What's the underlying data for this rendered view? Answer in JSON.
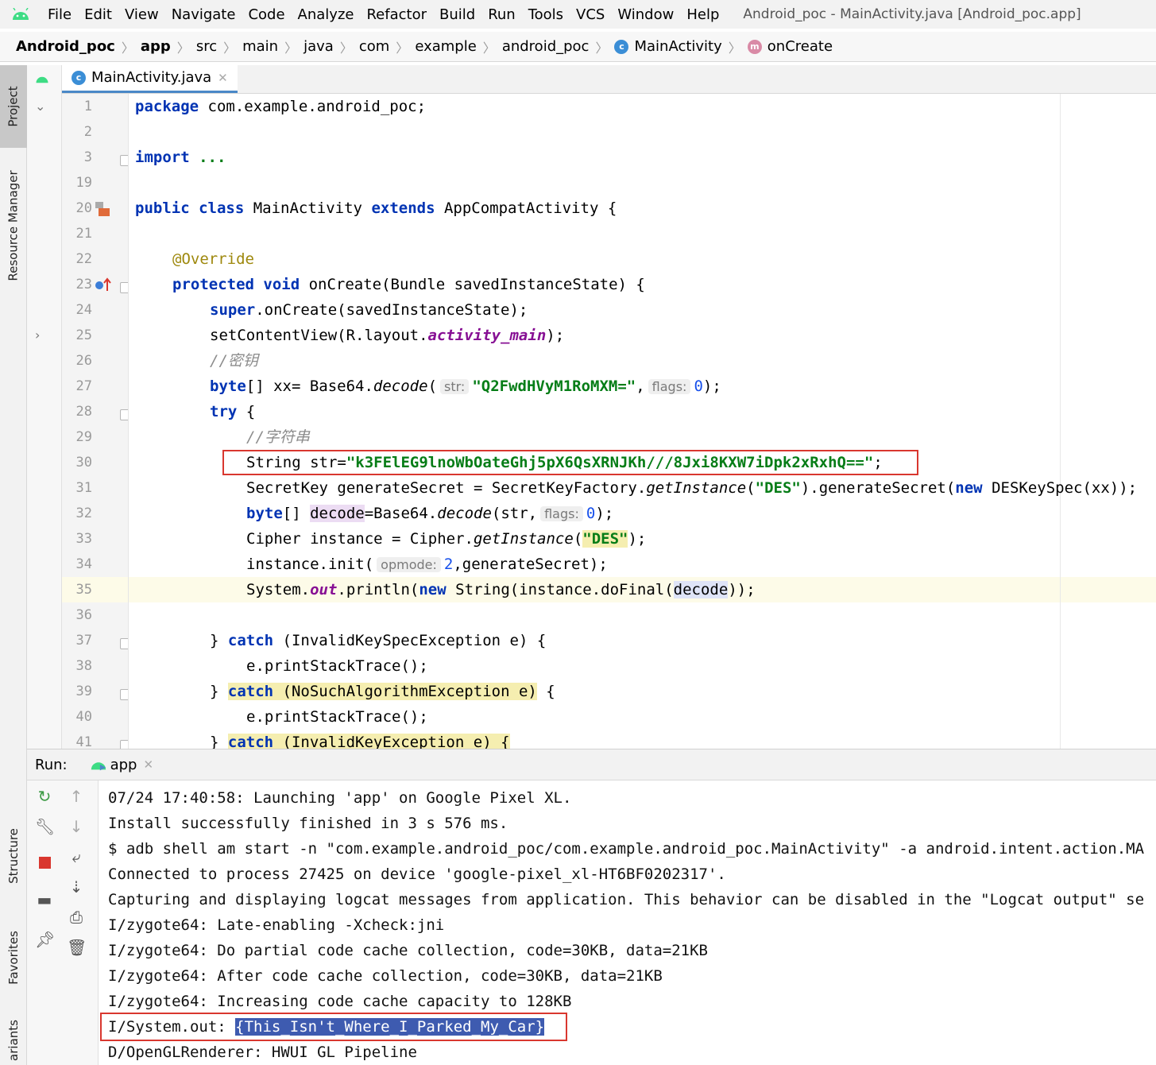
{
  "menubar": {
    "items": [
      "File",
      "Edit",
      "View",
      "Navigate",
      "Code",
      "Analyze",
      "Refactor",
      "Build",
      "Run",
      "Tools",
      "VCS",
      "Window",
      "Help"
    ],
    "window_title": "Android_poc - MainActivity.java [Android_poc.app]"
  },
  "breadcrumb": [
    "Android_poc",
    "app",
    "src",
    "main",
    "java",
    "com",
    "example",
    "android_poc",
    "MainActivity",
    "onCreate"
  ],
  "left_strip": {
    "project": "Project",
    "resource_manager": "Resource Manager",
    "structure": "Structure",
    "favorites": "Favorites",
    "variants": "ariants"
  },
  "editor": {
    "tab_label": "MainActivity.java",
    "badge_c": "c",
    "badge_m": "m",
    "line_numbers": [
      "1",
      "2",
      "3",
      "19",
      "20",
      "21",
      "22",
      "23",
      "24",
      "25",
      "26",
      "27",
      "28",
      "29",
      "30",
      "31",
      "32",
      "33",
      "34",
      "35",
      "36",
      "37",
      "38",
      "39",
      "40",
      "41"
    ],
    "code": {
      "l1_kw": "package",
      "l1_rest": " com.example.android_poc;",
      "l3_kw": "import",
      "l3_rest": " ...",
      "l20_kw1": "public class",
      "l20_mid": " MainActivity ",
      "l20_kw2": "extends",
      "l20_rest": " AppCompatActivity {",
      "l22_ann": "@Override",
      "l23_kw": "protected void",
      "l23_rest": " onCreate(Bundle savedInstanceState) {",
      "l24_kw": "super",
      "l24_rest": ".onCreate(savedInstanceState);",
      "l25_a": "setContentView(R.layout.",
      "l25_fld": "activity_main",
      "l25_b": ");",
      "l26_cmt": "//密钥",
      "l27_kw": "byte",
      "l27_a": "[] xx= Base64.",
      "l27_ital": "decode",
      "l27_b": "(",
      "l27_hint1": "str:",
      "l27_str": "\"Q2FwdHVyM1RoMXM=\"",
      "l27_c": ",",
      "l27_hint2": "flags:",
      "l27_num": "0",
      "l27_d": ");",
      "l28_kw": "try",
      "l28_rest": " {",
      "l29_cmt": "//字符串",
      "l30_a": "String str=",
      "l30_str": "\"k3FElEG9lnoWbOateGhj5pX6QsXRNJKh///8Jxi8KXW7iDpk2xRxhQ==\"",
      "l30_b": ";",
      "l31_a": "SecretKey generateSecret = SecretKeyFactory.",
      "l31_ital": "getInstance",
      "l31_b": "(",
      "l31_str": "\"DES\"",
      "l31_c": ").generateSecret(",
      "l31_kw": "new",
      "l31_d": " DESKeySpec(xx));",
      "l32_kw": "byte",
      "l32_a": "[] ",
      "l32_var": "decode",
      "l32_b": "=Base64.",
      "l32_ital": "decode",
      "l32_c": "(str,",
      "l32_hint": "flags:",
      "l32_num": "0",
      "l32_d": ");",
      "l33_a": "Cipher instance = Cipher.",
      "l33_ital": "getInstance",
      "l33_b": "(",
      "l33_str": "\"DES\"",
      "l33_c": ");",
      "l34_a": "instance.init(",
      "l34_hint": "opmode:",
      "l34_num": "2",
      "l34_b": ",generateSecret);",
      "l35_a": "System.",
      "l35_fld": "out",
      "l35_b": ".println(",
      "l35_kw": "new",
      "l35_c": " String(instance.doFinal(",
      "l35_var": "decode",
      "l35_d": "));",
      "l37_a": "} ",
      "l37_kw": "catch",
      "l37_b": " (InvalidKeySpecException e) {",
      "l38": "e.printStackTrace();",
      "l39_a": "} ",
      "l39_kw": "catch",
      "l39_b": " (NoSuchAlgorithmException e)",
      "l39_c": " {",
      "l40": "e.printStackTrace();",
      "l41_a": "} ",
      "l41_kw": "catch",
      "l41_b": " (InvalidKeyException e) {"
    }
  },
  "run": {
    "label": "Run:",
    "tab": "app",
    "console": [
      "07/24 17:40:58: Launching 'app' on Google Pixel XL.",
      "Install successfully finished in 3 s 576 ms.",
      "$ adb shell am start -n \"com.example.android_poc/com.example.android_poc.MainActivity\" -a android.intent.action.MA",
      "Connected to process 27425 on device 'google-pixel_xl-HT6BF0202317'.",
      "Capturing and displaying logcat messages from application. This behavior can be disabled in the \"Logcat output\" se",
      "I/zygote64: Late-enabling -Xcheck:jni",
      "I/zygote64: Do partial code cache collection, code=30KB, data=21KB",
      "I/zygote64: After code cache collection, code=30KB, data=21KB",
      "I/zygote64: Increasing code cache capacity to 128KB"
    ],
    "flag_prefix": "I/System.out: ",
    "flag_value": "{This_Isn't_Where_I_Parked_My_Car}",
    "last_line": "D/OpenGLRenderer: HWUI GL Pipeline"
  },
  "colors": {
    "keyword": "#0033b3",
    "string": "#067d17",
    "highlight_box": "#d9372f",
    "selection": "#3e5bb0"
  }
}
